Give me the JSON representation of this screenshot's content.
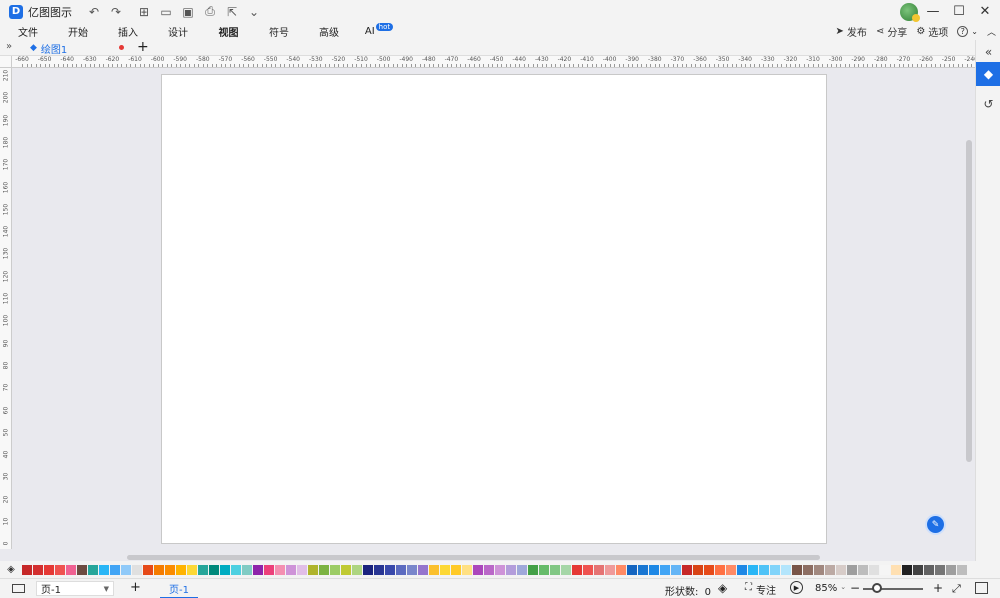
{
  "app": {
    "title": "亿图图示",
    "logo_letter": "D"
  },
  "quick_access": [
    {
      "name": "undo-icon",
      "glyph": "↶"
    },
    {
      "name": "redo-icon",
      "glyph": "↷"
    },
    {
      "name": "new-icon",
      "glyph": "⊞"
    },
    {
      "name": "open-icon",
      "glyph": "▭"
    },
    {
      "name": "save-icon",
      "glyph": "▣"
    },
    {
      "name": "print-icon",
      "glyph": "⎙"
    },
    {
      "name": "export-icon",
      "glyph": "⇱"
    },
    {
      "name": "more-icon",
      "glyph": "⌄"
    }
  ],
  "window_controls": {
    "minimize": "—",
    "maximize": "☐",
    "close": "✕"
  },
  "menu": {
    "items": [
      "文件",
      "开始",
      "插入",
      "设计",
      "视图",
      "符号",
      "高级",
      "AI"
    ],
    "active": "视图",
    "ai_badge": "hot"
  },
  "header_actions": {
    "publish": "发布",
    "share": "分享",
    "options": "选项",
    "help": "?"
  },
  "tabs": {
    "document": "绘图1",
    "new_tab": "+"
  },
  "ruler": {
    "horizontal": [
      -660,
      -650,
      -640,
      -630,
      -620,
      -610,
      -600,
      -590,
      -580,
      -570,
      -560,
      -550,
      -540,
      -530,
      -520,
      -510,
      -500,
      -490,
      -480,
      -470,
      -460,
      -450,
      -440,
      -430,
      -420,
      -410,
      -400,
      -390,
      -380,
      -370,
      -360,
      -350,
      -340,
      -330,
      -320,
      -310,
      -300,
      -290,
      -280,
      -270,
      -260,
      -250,
      -240
    ],
    "vertical": [
      210,
      200,
      190,
      180,
      170,
      160,
      150,
      140,
      130,
      120,
      110,
      100,
      90,
      80,
      70,
      60,
      50,
      40,
      30,
      20,
      10,
      0
    ]
  },
  "side_panel": {
    "collapse": "«",
    "fill_style": "fill-icon",
    "history": "history-icon"
  },
  "palette": {
    "fill_tool": "◈",
    "colors": [
      "#c62828",
      "#d32f2f",
      "#e53935",
      "#ef5350",
      "#f06292",
      "#6d4c41",
      "#26a69a",
      "#29b6f6",
      "#42a5f5",
      "#90caf9",
      "#e0e0e0",
      "#e64a19",
      "#f57c00",
      "#fb8c00",
      "#ffb300",
      "#fdd835",
      "#26a69a",
      "#00897b",
      "#00acc1",
      "#4dd0e1",
      "#80cbc4",
      "#8e24aa",
      "#ec407a",
      "#f48fb1",
      "#ce93d8",
      "#e1bee7",
      "#afb42b",
      "#7cb342",
      "#9ccc65",
      "#c0ca33",
      "#aed581",
      "#1a237e",
      "#283593",
      "#3949ab",
      "#5c6bc0",
      "#7986cb",
      "#9575cd",
      "#fbc02d",
      "#fdd835",
      "#ffca28",
      "#ffe082",
      "#ab47bc",
      "#ba68c8",
      "#ce93d8",
      "#b39ddb",
      "#9fa8da",
      "#43a047",
      "#66bb6a",
      "#81c784",
      "#a5d6a7",
      "#e53935",
      "#ef5350",
      "#e57373",
      "#ef9a9a",
      "#ff8a65",
      "#1565c0",
      "#1976d2",
      "#1e88e5",
      "#42a5f5",
      "#64b5f6",
      "#c62828",
      "#d84315",
      "#e64a19",
      "#ff7043",
      "#ff8a65",
      "#1e88e5",
      "#29b6f6",
      "#4fc3f7",
      "#81d4fa",
      "#b3e5fc",
      "#795548",
      "#8d6e63",
      "#a1887f",
      "#bcaaa4",
      "#d7ccc8",
      "#9e9e9e",
      "#bdbdbd",
      "#e0e0e0",
      "#f5f5f5",
      "#ffe0b2",
      "#212121",
      "#424242",
      "#616161",
      "#757575",
      "#9e9e9e",
      "#bdbdbd",
      "#e0e0e0",
      "#eeeeee"
    ]
  },
  "status": {
    "page_select": "页-1",
    "add_page": "+",
    "page_tab": "页-1",
    "shape_count_label": "形状数:",
    "shape_count": "0",
    "focus_label": "专注",
    "zoom": "85%",
    "zoom_minus": "−",
    "zoom_plus": "+"
  },
  "colors": {
    "accent": "#1e6fe5",
    "canvas_bg": "#e9e9ee",
    "page_bg": "#ffffff",
    "modified_dot": "#e53935"
  }
}
